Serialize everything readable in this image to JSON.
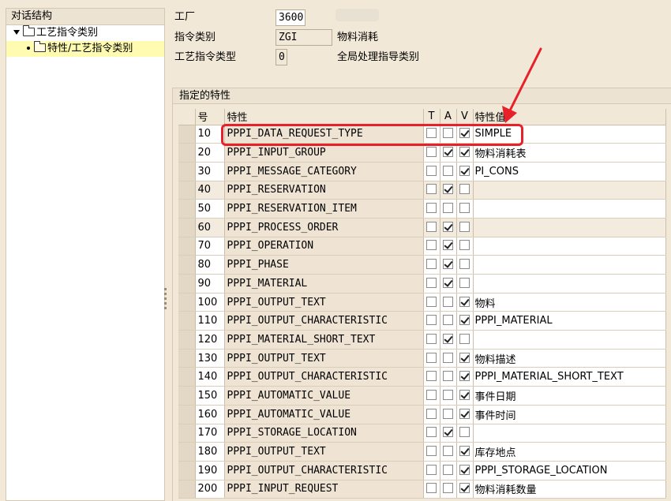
{
  "tree": {
    "header": "对话结构",
    "node1": "工艺指令类别",
    "node2": "特性/工艺指令类别"
  },
  "header": {
    "plant_label": "工厂",
    "plant_value": "3600",
    "category_label": "指令类别",
    "category_value": "ZGI",
    "category_desc": "物料消耗",
    "type_label": "工艺指令类型",
    "type_value": "0",
    "type_desc": "全局处理指导类别"
  },
  "table": {
    "group_title": "指定的特性",
    "columns": {
      "no": "号",
      "name": "特性",
      "t": "T",
      "a": "A",
      "v": "V",
      "value": "特性值"
    },
    "rows": [
      {
        "no": "10",
        "name": "PPPI_DATA_REQUEST_TYPE",
        "t": false,
        "a": false,
        "v": true,
        "value": "SIMPLE"
      },
      {
        "no": "20",
        "name": "PPPI_INPUT_GROUP",
        "t": false,
        "a": true,
        "v": true,
        "value": "物料消耗表"
      },
      {
        "no": "30",
        "name": "PPPI_MESSAGE_CATEGORY",
        "t": false,
        "a": false,
        "v": true,
        "value": "PI_CONS"
      },
      {
        "no": "40",
        "name": "PPPI_RESERVATION",
        "t": false,
        "a": true,
        "v": false,
        "value": ""
      },
      {
        "no": "50",
        "name": "PPPI_RESERVATION_ITEM",
        "t": false,
        "a": false,
        "v": false,
        "value": ""
      },
      {
        "no": "60",
        "name": "PPPI_PROCESS_ORDER",
        "t": false,
        "a": true,
        "v": false,
        "value": ""
      },
      {
        "no": "70",
        "name": "PPPI_OPERATION",
        "t": false,
        "a": true,
        "v": false,
        "value": ""
      },
      {
        "no": "80",
        "name": "PPPI_PHASE",
        "t": false,
        "a": true,
        "v": false,
        "value": ""
      },
      {
        "no": "90",
        "name": "PPPI_MATERIAL",
        "t": false,
        "a": true,
        "v": false,
        "value": ""
      },
      {
        "no": "100",
        "name": "PPPI_OUTPUT_TEXT",
        "t": false,
        "a": false,
        "v": true,
        "value": "物料"
      },
      {
        "no": "110",
        "name": "PPPI_OUTPUT_CHARACTERISTIC",
        "t": false,
        "a": false,
        "v": true,
        "value": "PPPI_MATERIAL"
      },
      {
        "no": "120",
        "name": "PPPI_MATERIAL_SHORT_TEXT",
        "t": false,
        "a": true,
        "v": false,
        "value": ""
      },
      {
        "no": "130",
        "name": "PPPI_OUTPUT_TEXT",
        "t": false,
        "a": false,
        "v": true,
        "value": "物料描述"
      },
      {
        "no": "140",
        "name": "PPPI_OUTPUT_CHARACTERISTIC",
        "t": false,
        "a": false,
        "v": true,
        "value": "PPPI_MATERIAL_SHORT_TEXT"
      },
      {
        "no": "150",
        "name": "PPPI_AUTOMATIC_VALUE",
        "t": false,
        "a": false,
        "v": true,
        "value": "事件日期"
      },
      {
        "no": "160",
        "name": "PPPI_AUTOMATIC_VALUE",
        "t": false,
        "a": false,
        "v": true,
        "value": "事件时间"
      },
      {
        "no": "170",
        "name": "PPPI_STORAGE_LOCATION",
        "t": false,
        "a": true,
        "v": false,
        "value": ""
      },
      {
        "no": "180",
        "name": "PPPI_OUTPUT_TEXT",
        "t": false,
        "a": false,
        "v": true,
        "value": "库存地点"
      },
      {
        "no": "190",
        "name": "PPPI_OUTPUT_CHARACTERISTIC",
        "t": false,
        "a": false,
        "v": true,
        "value": "PPPI_STORAGE_LOCATION"
      },
      {
        "no": "200",
        "name": "PPPI_INPUT_REQUEST",
        "t": false,
        "a": false,
        "v": true,
        "value": "物料消耗数量"
      }
    ]
  },
  "colors": {
    "highlight": "#e8202a",
    "background": "#f2e8d8",
    "tree_selected": "#fffbb0"
  }
}
